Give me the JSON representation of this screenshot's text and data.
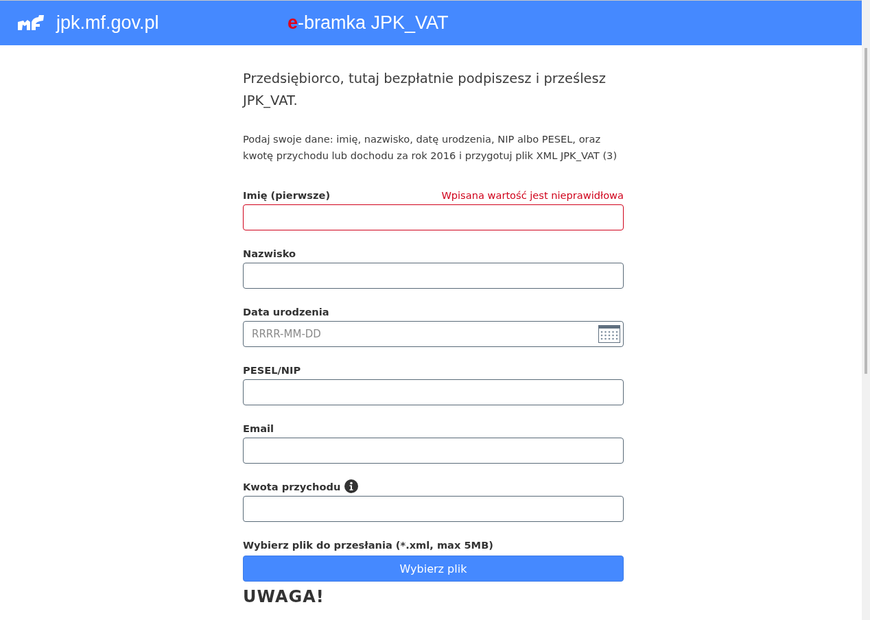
{
  "header": {
    "site": "jpk.mf.gov.pl",
    "title_mark": "e",
    "title": "-bramka JPK_VAT"
  },
  "intro": "Przedsiębiorco, tutaj bezpłatnie podpiszesz i prześlesz JPK_VAT.",
  "instructions": "Podaj swoje dane: imię, nazwisko, datę urodzenia, NIP albo PESEL, oraz kwotę przychodu lub dochodu za rok 2016 i przygotuj plik XML JPK_VAT (3)",
  "fields": [
    {
      "kind": "text",
      "label": "Imię (pierwsze)",
      "error": "Wpisana wartość jest nieprawidłowa",
      "invalid": true,
      "info": false
    },
    {
      "kind": "text",
      "label": "Nazwisko",
      "invalid": false,
      "info": false
    },
    {
      "kind": "date",
      "label": "Data urodzenia",
      "placeholder": "RRRR-MM-DD",
      "invalid": false,
      "info": false
    },
    {
      "kind": "text",
      "label": "PESEL/NIP",
      "invalid": false,
      "info": false
    },
    {
      "kind": "text",
      "label": "Email",
      "invalid": false,
      "info": false
    },
    {
      "kind": "text",
      "label": "Kwota przychodu",
      "invalid": false,
      "info": true
    }
  ],
  "file": {
    "label": "Wybierz plik do przesłania (*.xml, max 5MB)",
    "button": "Wybierz plik"
  },
  "warning_heading": "UWAGA!"
}
